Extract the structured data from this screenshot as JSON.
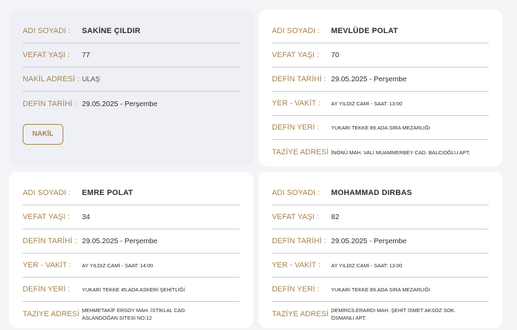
{
  "labels": {
    "name": "ADI SOYADI :",
    "age": "VEFAT YAŞI :",
    "address": "NAKİL ADRESİ :",
    "burial_date": "DEFİN TARİHİ :",
    "place_time": "YER - VAKİT :",
    "burial_place": "DEFİN YERİ :",
    "condolence": "TAZİYE ADRESİ :"
  },
  "cards": [
    {
      "name": "SAKİNE ÇILDIR",
      "age": "77",
      "address": "ULAŞ",
      "burial_date": "29.05.2025 - Perşembe",
      "button": "NAKİL"
    },
    {
      "name": "MEVLÜDE POLAT",
      "age": "70",
      "burial_date": "29.05.2025 - Perşembe",
      "place_time": "AY YILDIZ CAMİ - SAAT: 13:00",
      "burial_place": "YUKARI TEKKE 89.ADA SIRA MEZARLIĞI",
      "condolence": "İNÖNÜ MAH. VALİ MUAMMERBEY CAD. BALCIOĞLU APT."
    },
    {
      "name": "EMRE POLAT",
      "age": "34",
      "burial_date": "29.05.2025 - Perşembe",
      "place_time": "AY YILDIZ CAMİ - SAAT: 14:00",
      "burial_place": "YUKARI TEKKE 45.ADA ASKERİ ŞEHİTLİĞİ",
      "condolence": "MEHMETAKİF ERSOY MAH. İSTİKLAL CAD. ASLANDOĞAN SİTESİ NO:12"
    },
    {
      "name": "MOHAMMAD DIRBAS",
      "age": "82",
      "burial_date": "29.05.2025 - Perşembe",
      "place_time": "AY YILDIZ CAMİ - SAAT: 13:00",
      "burial_place": "YUKARI TEKKE 89.ADA SIRA MEZARLIĞI",
      "condolence": "DEMİRCİLERARDI MAH. ŞEHİT İSMET AKSÖZ SOK. OSMANLI APT."
    }
  ]
}
